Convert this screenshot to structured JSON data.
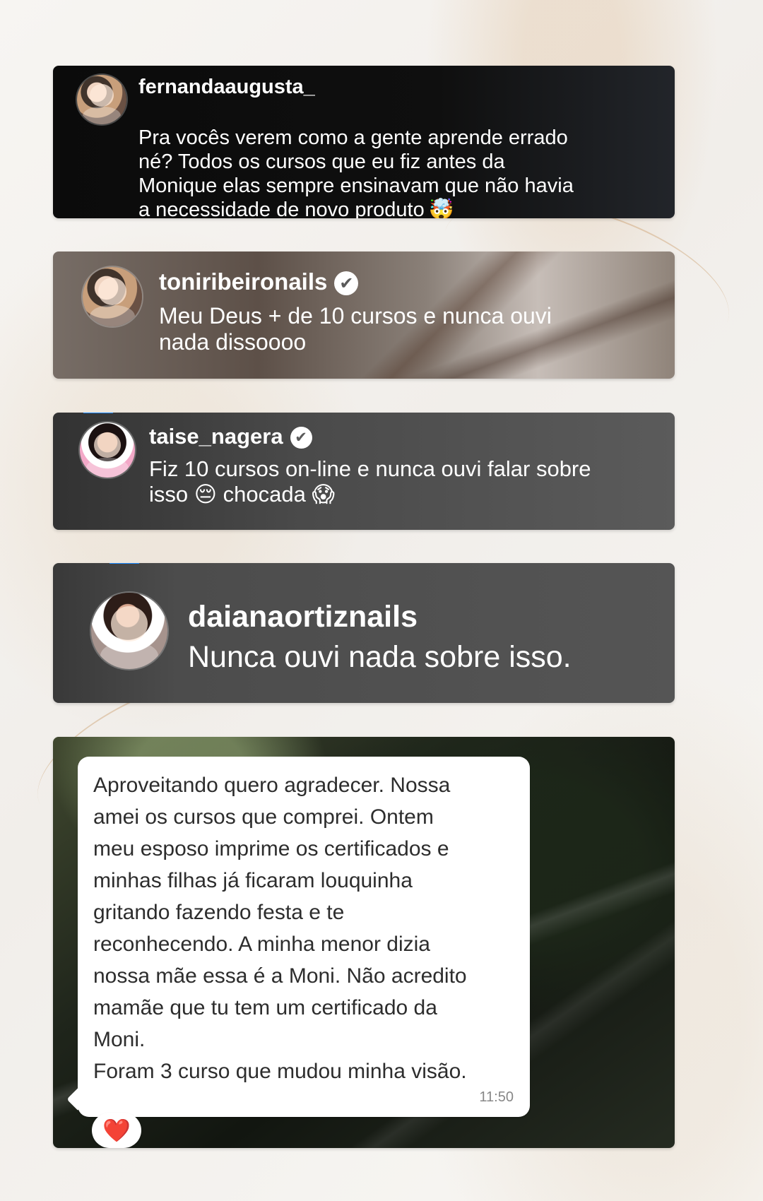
{
  "comments": [
    {
      "username": "fernandaaugusta_",
      "message": "Pra vocês verem como a gente aprende errado\nné? Todos os cursos que eu fiz antes da\nMonique elas sempre ensinavam que não havia\na necessidade de novo produto",
      "emoji": "🤯",
      "verified": false
    },
    {
      "username": "toniribeironails",
      "message": "Meu Deus + de 10 cursos e nunca ouvi\nnada dissoooo",
      "verified": true
    },
    {
      "username": "taise_nagera",
      "message": "Fiz 10 cursos on-line e nunca ouvi falar sobre\nisso 😔 chocada 😱",
      "verified": true
    },
    {
      "username": "daianaortiznails",
      "message": "Nunca ouvi nada sobre isso.",
      "verified": false
    }
  ],
  "chat": {
    "message": "Aproveitando quero agradecer. Nossa\namei os cursos que comprei. Ontem\nmeu esposo imprime os certificados e\nminhas filhas já ficaram louquinha\ngritando fazendo festa e te\nreconhecendo. A minha menor dizia\nnossa mãe essa é a Moni. Não acredito\nmamãe que tu tem um certificado da\nMoni.\nForam 3 curso que mudou minha visão.",
    "time": "11:50",
    "reaction": "❤️"
  },
  "icons": {
    "verified": "verified-badge-icon",
    "reaction": "heart-icon"
  }
}
